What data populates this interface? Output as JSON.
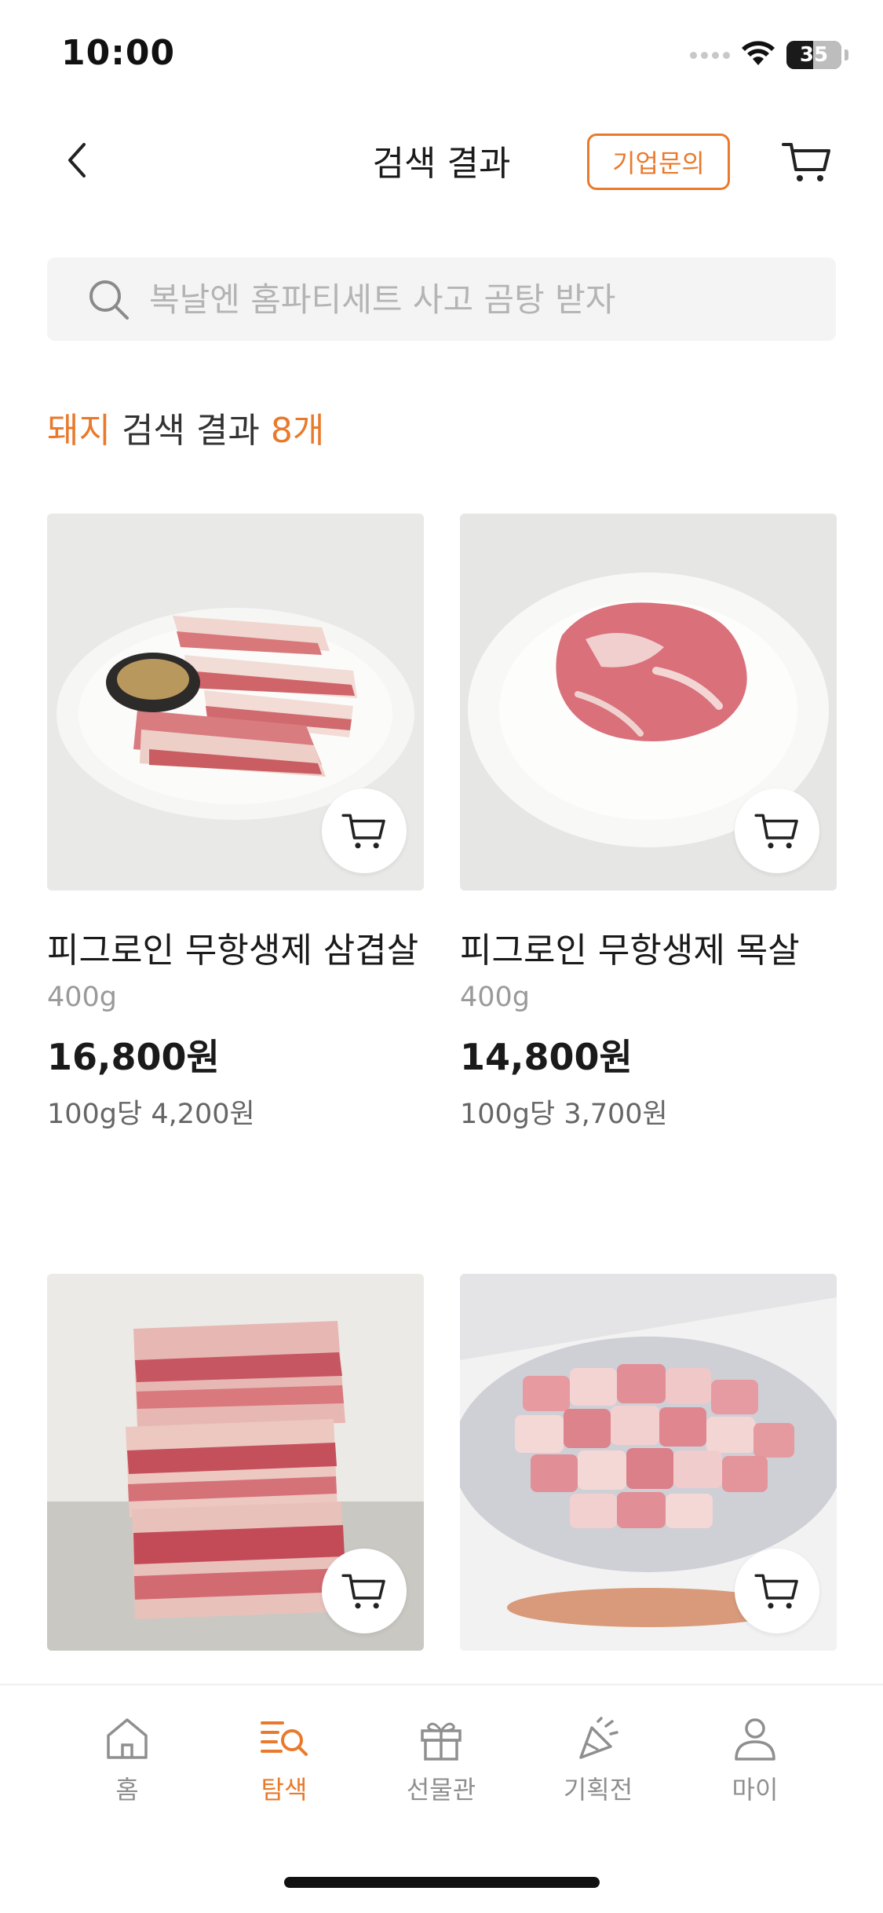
{
  "status_bar": {
    "time": "10:00",
    "battery": "35"
  },
  "header": {
    "title": "검색 결과",
    "inquiry_label": "기업문의"
  },
  "search": {
    "placeholder": "복날엔 홈파티세트 사고 곰탕 받자"
  },
  "results": {
    "keyword": "돼지",
    "label": " 검색 결과 ",
    "count": "8개"
  },
  "products": [
    {
      "name": "피그로인 무항생제 삼겹살",
      "weight": "400g",
      "price": "16,800원",
      "unit_price": "100g당 4,200원"
    },
    {
      "name": "피그로인 무항생제 목살",
      "weight": "400g",
      "price": "14,800원",
      "unit_price": "100g당 3,700원"
    },
    {
      "name": "",
      "weight": "",
      "price": "",
      "unit_price": ""
    },
    {
      "name": "",
      "weight": "",
      "price": "",
      "unit_price": ""
    }
  ],
  "tabbar": {
    "items": [
      {
        "label": "홈",
        "icon": "home-icon"
      },
      {
        "label": "탐색",
        "icon": "explore-icon"
      },
      {
        "label": "선물관",
        "icon": "gift-icon"
      },
      {
        "label": "기획전",
        "icon": "party-icon"
      },
      {
        "label": "마이",
        "icon": "person-icon"
      }
    ],
    "active": "탐색"
  },
  "colors": {
    "accent": "#e97a2c",
    "text": "#1a1a1a",
    "muted": "#9a9a9a",
    "search_bg": "#f4f4f4"
  }
}
